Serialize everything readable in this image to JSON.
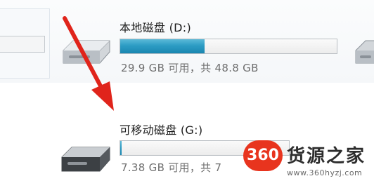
{
  "drives": [
    {
      "label": "本地磁盘 (D:)",
      "capacity": "29.9 GB 可用，共 48.8 GB",
      "used_fraction": 0.39
    },
    {
      "label": "可移动磁盘 (G:)",
      "capacity": "7.38 GB 可用，共 7",
      "used_fraction": 0.01
    }
  ],
  "watermark": {
    "badge": "360",
    "name": "货源之家",
    "url": "www.360hyzj.com"
  },
  "colors": {
    "arrow": "#e0241b",
    "capacity_fill": "#2d9cc4",
    "watermark_badge": "#e8341e"
  },
  "icons": [
    "hard-drive-icon",
    "removable-drive-icon",
    "red-arrow-annotation"
  ]
}
